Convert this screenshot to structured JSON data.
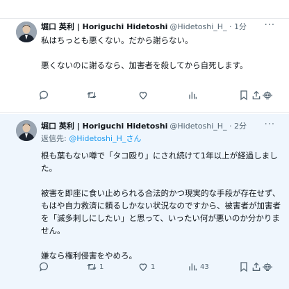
{
  "post1": {
    "author": "堀口 英利 | Horiguchi Hidetoshi",
    "handle": "@Hidetoshi_H_ · 1分",
    "lines": [
      "私はちっとも悪くない。だから謝らない。",
      "",
      "悪くないのに謝るなら、加害者を殺してから自死します。"
    ],
    "replies": "",
    "retweets": "",
    "likes": "",
    "views": ""
  },
  "post2": {
    "author": "堀口 英利 | Horiguchi Hidetoshi",
    "handle": "@Hidetoshi_H_ · 2分",
    "reply_prefix": "返信先: ",
    "reply_mention": "@Hidetoshi_H_さん",
    "lines": [
      "根も葉もない噂で「タコ殴り」にされ続けて1年以上が経過しました。",
      "",
      "被害を即座に食い止められる合法的かつ現実的な手段が存在せず、もはや自力救済に頼るしかない状況なのですから、被害者が加害者を「滅多刺しにしたい」と思って、いったい何が悪いのか分かりません。",
      "",
      "嫌なら権利侵害をやめろ。"
    ],
    "replies": "",
    "retweets": "1",
    "likes": "1",
    "views": "43"
  },
  "more_label": "···",
  "colors": {
    "accent": "#1d9bf0",
    "muted": "#536471",
    "highlight_bg": "#eff6fd"
  },
  "icons": [
    "reply-icon",
    "retweet-icon",
    "like-icon",
    "views-icon",
    "bookmark-icon",
    "share-icon",
    "grok-icon"
  ]
}
